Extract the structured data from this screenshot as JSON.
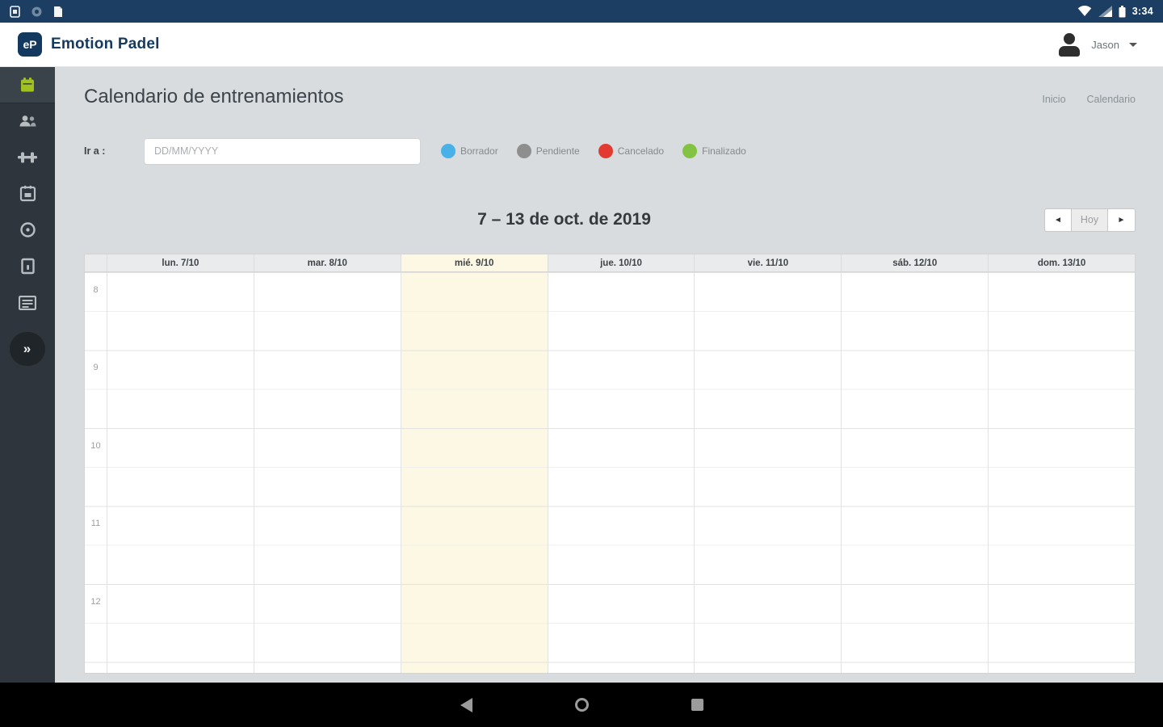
{
  "status_bar": {
    "time": "3:34",
    "notification_icons": [
      "screenshot-icon",
      "vpn-circle-icon",
      "file-icon"
    ],
    "system_icons": [
      "wifi-icon",
      "cellular-signal-icon",
      "battery-icon"
    ]
  },
  "app_bar": {
    "logo": "eP",
    "brand": "Emotion Padel",
    "user": {
      "name": "Jason"
    }
  },
  "sidebar": {
    "items": [
      {
        "icon": "calendar-icon",
        "active": true,
        "accent_color": "#a0c120"
      },
      {
        "icon": "users-icon",
        "active": false
      },
      {
        "icon": "dumbbell-icon",
        "active": false
      },
      {
        "icon": "schedule-icon",
        "active": false
      },
      {
        "icon": "ball-icon",
        "active": false
      },
      {
        "icon": "door-icon",
        "active": false
      },
      {
        "icon": "table-icon",
        "active": false
      }
    ],
    "collapse_glyph": "»"
  },
  "page": {
    "title": "Calendario de entrenamientos",
    "breadcrumb": [
      "Inicio",
      "Calendario"
    ]
  },
  "goto": {
    "label": "Ir a :",
    "placeholder": "DD/MM/YYYY",
    "value": ""
  },
  "legend": {
    "items": [
      {
        "label": "Borrador",
        "color": "#47b1e8"
      },
      {
        "label": "Pendiente",
        "color": "#8e8e8e"
      },
      {
        "label": "Cancelado",
        "color": "#e23a30"
      },
      {
        "label": "Finalizado",
        "color": "#82c341"
      }
    ]
  },
  "calendar": {
    "title": "7 – 13 de oct. de 2019",
    "nav": {
      "prev": "◄",
      "today": "Hoy",
      "next": "►"
    },
    "days": [
      {
        "label": "lun. 7/10",
        "today": false
      },
      {
        "label": "mar. 8/10",
        "today": false
      },
      {
        "label": "mié. 9/10",
        "today": true
      },
      {
        "label": "jue. 10/10",
        "today": false
      },
      {
        "label": "vie. 11/10",
        "today": false
      },
      {
        "label": "sáb. 12/10",
        "today": false
      },
      {
        "label": "dom. 13/10",
        "today": false
      }
    ],
    "hours": [
      "8",
      "9",
      "10",
      "11",
      "12"
    ],
    "today_highlight_color": "#fcf8e3"
  },
  "android_nav": {
    "icons": [
      "back-icon",
      "home-icon",
      "recents-icon"
    ]
  }
}
